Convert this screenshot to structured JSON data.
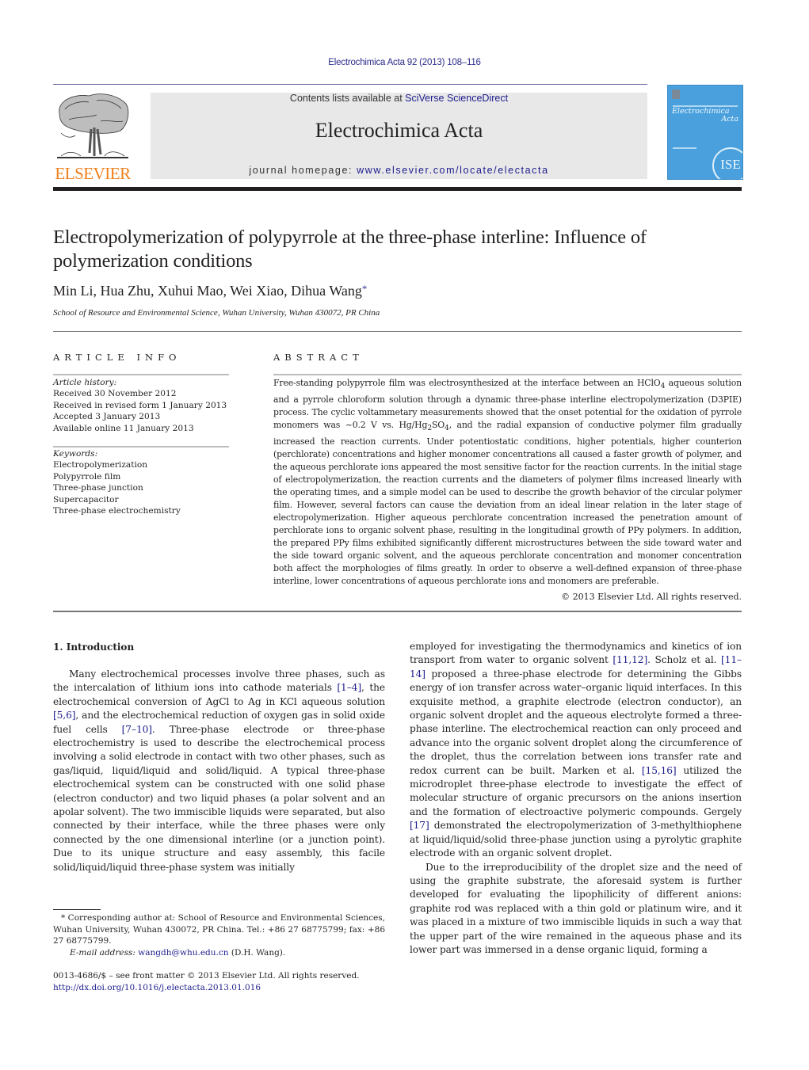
{
  "journal_citation": "Electrochimica Acta 92 (2013) 108–116",
  "masthead": {
    "contents_prefix": "Contents lists available at ",
    "contents_link": "SciVerse ScienceDirect",
    "journal_title": "Electrochimica Acta",
    "homepage_prefix": "journal homepage: ",
    "homepage_link": "www.elsevier.com/locate/electacta",
    "publisher": "ELSEVIER",
    "cover_title_line1": "Electrochimica",
    "cover_title_line2": "Acta",
    "cover_badge": "ISE"
  },
  "colors": {
    "link": "#1c1c8c",
    "elsevier_orange": "#f07f1a",
    "cover_blue": "#4aa0dc",
    "masthead_gray": "#e8e8e9"
  },
  "article": {
    "title": "Electropolymerization of polypyrrole at the three-phase interline: Influence of polymerization conditions",
    "authors": "Min Li, Hua Zhu, Xuhui Mao, Wei Xiao, Dihua Wang",
    "corresponding_mark": "*",
    "affiliation": "School of Resource and Environmental Science, Wuhan University, Wuhan 430072, PR China"
  },
  "article_info": {
    "label": "ARTICLE INFO",
    "history_heading": "Article history:",
    "history": [
      "Received 30 November 2012",
      "Received in revised form 1 January 2013",
      "Accepted 3 January 2013",
      "Available online 11 January 2013"
    ],
    "keywords_heading": "Keywords:",
    "keywords": [
      "Electropolymerization",
      "Polypyrrole film",
      "Three-phase junction",
      "Supercapacitor",
      "Three-phase electrochemistry"
    ]
  },
  "abstract": {
    "label": "ABSTRACT",
    "part1": "Free-standing polypyrrole film was electrosynthesized at the interface between an HClO",
    "sub1": "4",
    "part2": " aqueous solution and a pyrrole chloroform solution through a dynamic three-phase interline electropolymerization (D3PIE) process. The cyclic voltammetary measurements showed that the onset potential for the oxidation of pyrrole monomers was ~0.2 V vs. Hg/Hg",
    "sub2": "2",
    "part3": "SO",
    "sub3": "4",
    "part4": ", and the radial expansion of conductive polymer film gradually increased the reaction currents. Under potentiostatic conditions, higher potentials, higher counterion (perchlorate) concentrations and higher monomer concentrations all caused a faster growth of polymer, and the aqueous perchlorate ions appeared the most sensitive factor for the reaction currents. In the initial stage of electropolymerization, the reaction currents and the diameters of polymer films increased linearly with the operating times, and a simple model can be used to describe the growth behavior of the circular polymer film. However, several factors can cause the deviation from an ideal linear relation in the later stage of electropolymerization. Higher aqueous perchlorate concentration increased the penetration amount of perchlorate ions to organic solvent phase, resulting in the longitudinal growth of PPy polymers. In addition, the prepared PPy films exhibited significantly different microstructures between the side toward water and the side toward organic solvent, and the aqueous perchlorate concentration and monomer concentration both affect the morphologies of films greatly. In order to observe a well-defined expansion of three-phase interline, lower concentrations of aqueous perchlorate ions and monomers are preferable.",
    "copyright": "© 2013 Elsevier Ltd. All rights reserved."
  },
  "introduction": {
    "heading": "1.  Introduction",
    "left": {
      "s1": "Many electrochemical processes involve three phases, such as the intercalation of lithium ions into cathode materials ",
      "r1": "[1–4]",
      "s2": ", the electrochemical conversion of AgCl to Ag in KCl aqueous solution ",
      "r2": "[5,6]",
      "s3": ", and the electrochemical reduction of oxygen gas in solid oxide fuel cells ",
      "r3": "[7–10]",
      "s4": ". Three-phase electrode or three-phase electrochemistry is used to describe the electrochemical process involving a solid electrode in contact with two other phases, such as gas/liquid, liquid/liquid and solid/liquid. A typical three-phase electrochemical system can be constructed with one solid phase (electron conductor) and two liquid phases (a polar solvent and an apolar solvent). The two immiscible liquids were separated, but also connected by their interface, while the three phases were only connected by the one dimensional interline (or a junction point). Due to its unique structure and easy assembly, this facile solid/liquid/liquid three-phase system was initially"
    },
    "right": {
      "s1": "employed for investigating the thermodynamics and kinetics of ion transport from water to organic solvent ",
      "r1": "[11,12]",
      "s2": ". Scholz et al. ",
      "r2": "[11–14]",
      "s3": " proposed a three-phase electrode for determining the Gibbs energy of ion transfer across water–organic liquid interfaces. In this exquisite method, a graphite electrode (electron conductor), an organic solvent droplet and the aqueous electrolyte formed a three-phase interline. The electrochemical reaction can only proceed and advance into the organic solvent droplet along the circumference of the droplet, thus the correlation between ions transfer rate and redox current can be built. Marken et al. ",
      "r3": "[15,16]",
      "s4": " utilized the microdroplet three-phase electrode to investigate the effect of molecular structure of organic precursors on the anions insertion and the formation of electroactive polymeric compounds. Gergely ",
      "r4": "[17]",
      "s5": " demonstrated the electropolymerization of 3-methylthiophene at liquid/liquid/solid three-phase junction using a pyrolytic graphite electrode with an organic solvent droplet.",
      "p2": "Due to the irreproducibility of the droplet size and the need of using the graphite substrate, the aforesaid system is further developed for evaluating the lipophilicity of different anions: graphite rod was replaced with a thin gold or platinum wire, and it was placed in a mixture of two immiscible liquids in such a way that the upper part of the wire remained in the aqueous phase and its lower part was immersed in a dense organic liquid, forming a"
    }
  },
  "footnote": {
    "corresponding": "* Corresponding author at: School of Resource and Environmental Sciences, Wuhan University, Wuhan 430072, PR China. Tel.: +86 27 68775799; fax: +86 27 68775799.",
    "email_label": "E-mail address: ",
    "email": "wangdh@whu.edu.cn",
    "email_suffix": " (D.H. Wang).",
    "issn_line": "0013-4686/$ – see front matter © 2013 Elsevier Ltd. All rights reserved.",
    "doi": "http://dx.doi.org/10.1016/j.electacta.2013.01.016"
  }
}
